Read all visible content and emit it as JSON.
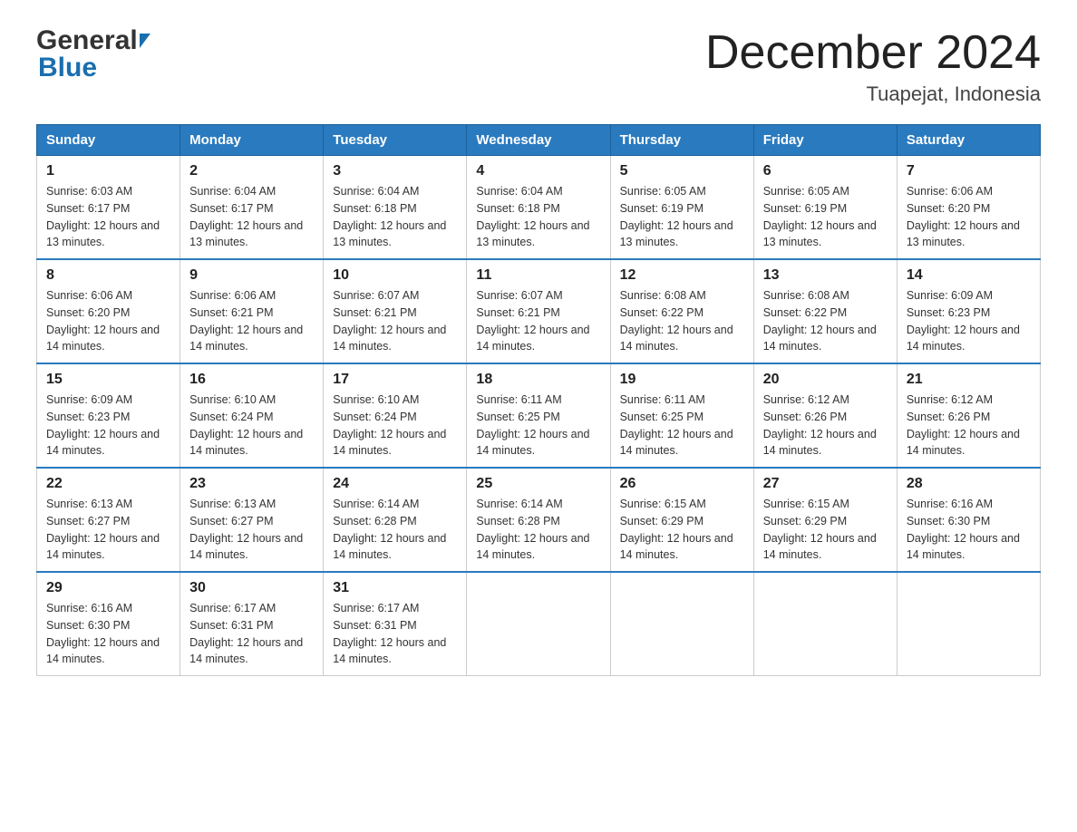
{
  "header": {
    "logo_general": "General",
    "logo_blue": "Blue",
    "title": "December 2024",
    "subtitle": "Tuapejat, Indonesia"
  },
  "calendar": {
    "days_of_week": [
      "Sunday",
      "Monday",
      "Tuesday",
      "Wednesday",
      "Thursday",
      "Friday",
      "Saturday"
    ],
    "weeks": [
      [
        {
          "day": "1",
          "sunrise": "6:03 AM",
          "sunset": "6:17 PM",
          "daylight": "12 hours and 13 minutes."
        },
        {
          "day": "2",
          "sunrise": "6:04 AM",
          "sunset": "6:17 PM",
          "daylight": "12 hours and 13 minutes."
        },
        {
          "day": "3",
          "sunrise": "6:04 AM",
          "sunset": "6:18 PM",
          "daylight": "12 hours and 13 minutes."
        },
        {
          "day": "4",
          "sunrise": "6:04 AM",
          "sunset": "6:18 PM",
          "daylight": "12 hours and 13 minutes."
        },
        {
          "day": "5",
          "sunrise": "6:05 AM",
          "sunset": "6:19 PM",
          "daylight": "12 hours and 13 minutes."
        },
        {
          "day": "6",
          "sunrise": "6:05 AM",
          "sunset": "6:19 PM",
          "daylight": "12 hours and 13 minutes."
        },
        {
          "day": "7",
          "sunrise": "6:06 AM",
          "sunset": "6:20 PM",
          "daylight": "12 hours and 13 minutes."
        }
      ],
      [
        {
          "day": "8",
          "sunrise": "6:06 AM",
          "sunset": "6:20 PM",
          "daylight": "12 hours and 14 minutes."
        },
        {
          "day": "9",
          "sunrise": "6:06 AM",
          "sunset": "6:21 PM",
          "daylight": "12 hours and 14 minutes."
        },
        {
          "day": "10",
          "sunrise": "6:07 AM",
          "sunset": "6:21 PM",
          "daylight": "12 hours and 14 minutes."
        },
        {
          "day": "11",
          "sunrise": "6:07 AM",
          "sunset": "6:21 PM",
          "daylight": "12 hours and 14 minutes."
        },
        {
          "day": "12",
          "sunrise": "6:08 AM",
          "sunset": "6:22 PM",
          "daylight": "12 hours and 14 minutes."
        },
        {
          "day": "13",
          "sunrise": "6:08 AM",
          "sunset": "6:22 PM",
          "daylight": "12 hours and 14 minutes."
        },
        {
          "day": "14",
          "sunrise": "6:09 AM",
          "sunset": "6:23 PM",
          "daylight": "12 hours and 14 minutes."
        }
      ],
      [
        {
          "day": "15",
          "sunrise": "6:09 AM",
          "sunset": "6:23 PM",
          "daylight": "12 hours and 14 minutes."
        },
        {
          "day": "16",
          "sunrise": "6:10 AM",
          "sunset": "6:24 PM",
          "daylight": "12 hours and 14 minutes."
        },
        {
          "day": "17",
          "sunrise": "6:10 AM",
          "sunset": "6:24 PM",
          "daylight": "12 hours and 14 minutes."
        },
        {
          "day": "18",
          "sunrise": "6:11 AM",
          "sunset": "6:25 PM",
          "daylight": "12 hours and 14 minutes."
        },
        {
          "day": "19",
          "sunrise": "6:11 AM",
          "sunset": "6:25 PM",
          "daylight": "12 hours and 14 minutes."
        },
        {
          "day": "20",
          "sunrise": "6:12 AM",
          "sunset": "6:26 PM",
          "daylight": "12 hours and 14 minutes."
        },
        {
          "day": "21",
          "sunrise": "6:12 AM",
          "sunset": "6:26 PM",
          "daylight": "12 hours and 14 minutes."
        }
      ],
      [
        {
          "day": "22",
          "sunrise": "6:13 AM",
          "sunset": "6:27 PM",
          "daylight": "12 hours and 14 minutes."
        },
        {
          "day": "23",
          "sunrise": "6:13 AM",
          "sunset": "6:27 PM",
          "daylight": "12 hours and 14 minutes."
        },
        {
          "day": "24",
          "sunrise": "6:14 AM",
          "sunset": "6:28 PM",
          "daylight": "12 hours and 14 minutes."
        },
        {
          "day": "25",
          "sunrise": "6:14 AM",
          "sunset": "6:28 PM",
          "daylight": "12 hours and 14 minutes."
        },
        {
          "day": "26",
          "sunrise": "6:15 AM",
          "sunset": "6:29 PM",
          "daylight": "12 hours and 14 minutes."
        },
        {
          "day": "27",
          "sunrise": "6:15 AM",
          "sunset": "6:29 PM",
          "daylight": "12 hours and 14 minutes."
        },
        {
          "day": "28",
          "sunrise": "6:16 AM",
          "sunset": "6:30 PM",
          "daylight": "12 hours and 14 minutes."
        }
      ],
      [
        {
          "day": "29",
          "sunrise": "6:16 AM",
          "sunset": "6:30 PM",
          "daylight": "12 hours and 14 minutes."
        },
        {
          "day": "30",
          "sunrise": "6:17 AM",
          "sunset": "6:31 PM",
          "daylight": "12 hours and 14 minutes."
        },
        {
          "day": "31",
          "sunrise": "6:17 AM",
          "sunset": "6:31 PM",
          "daylight": "12 hours and 14 minutes."
        },
        null,
        null,
        null,
        null
      ]
    ]
  }
}
